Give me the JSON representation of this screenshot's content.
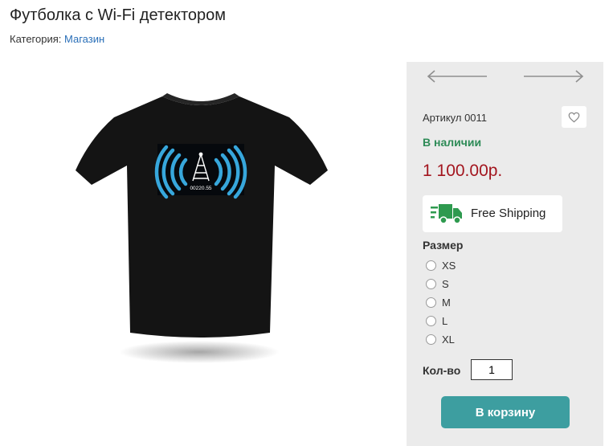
{
  "product": {
    "title": "Футболка с Wi-Fi детектором",
    "category_label": "Категория:",
    "category_link": "Магазин",
    "image_print_text": "00220.55"
  },
  "panel": {
    "sku": "Артикул 0011",
    "stock": "В наличии",
    "price": "1 100.00р.",
    "shipping": "Free Shipping",
    "size_label": "Размер",
    "sizes": [
      "XS",
      "S",
      "M",
      "L",
      "XL"
    ],
    "qty_label": "Кол-во",
    "qty_value": "1",
    "cart_button": "В корзину"
  },
  "colors": {
    "accent": "#3d9ea0",
    "price": "#a3161f",
    "stock": "#2e8b57",
    "link": "#2a6fb8",
    "panel_bg": "#ebebeb"
  },
  "icons": [
    "arrow-left-icon",
    "arrow-right-icon",
    "heart-icon",
    "delivery-truck-icon"
  ]
}
